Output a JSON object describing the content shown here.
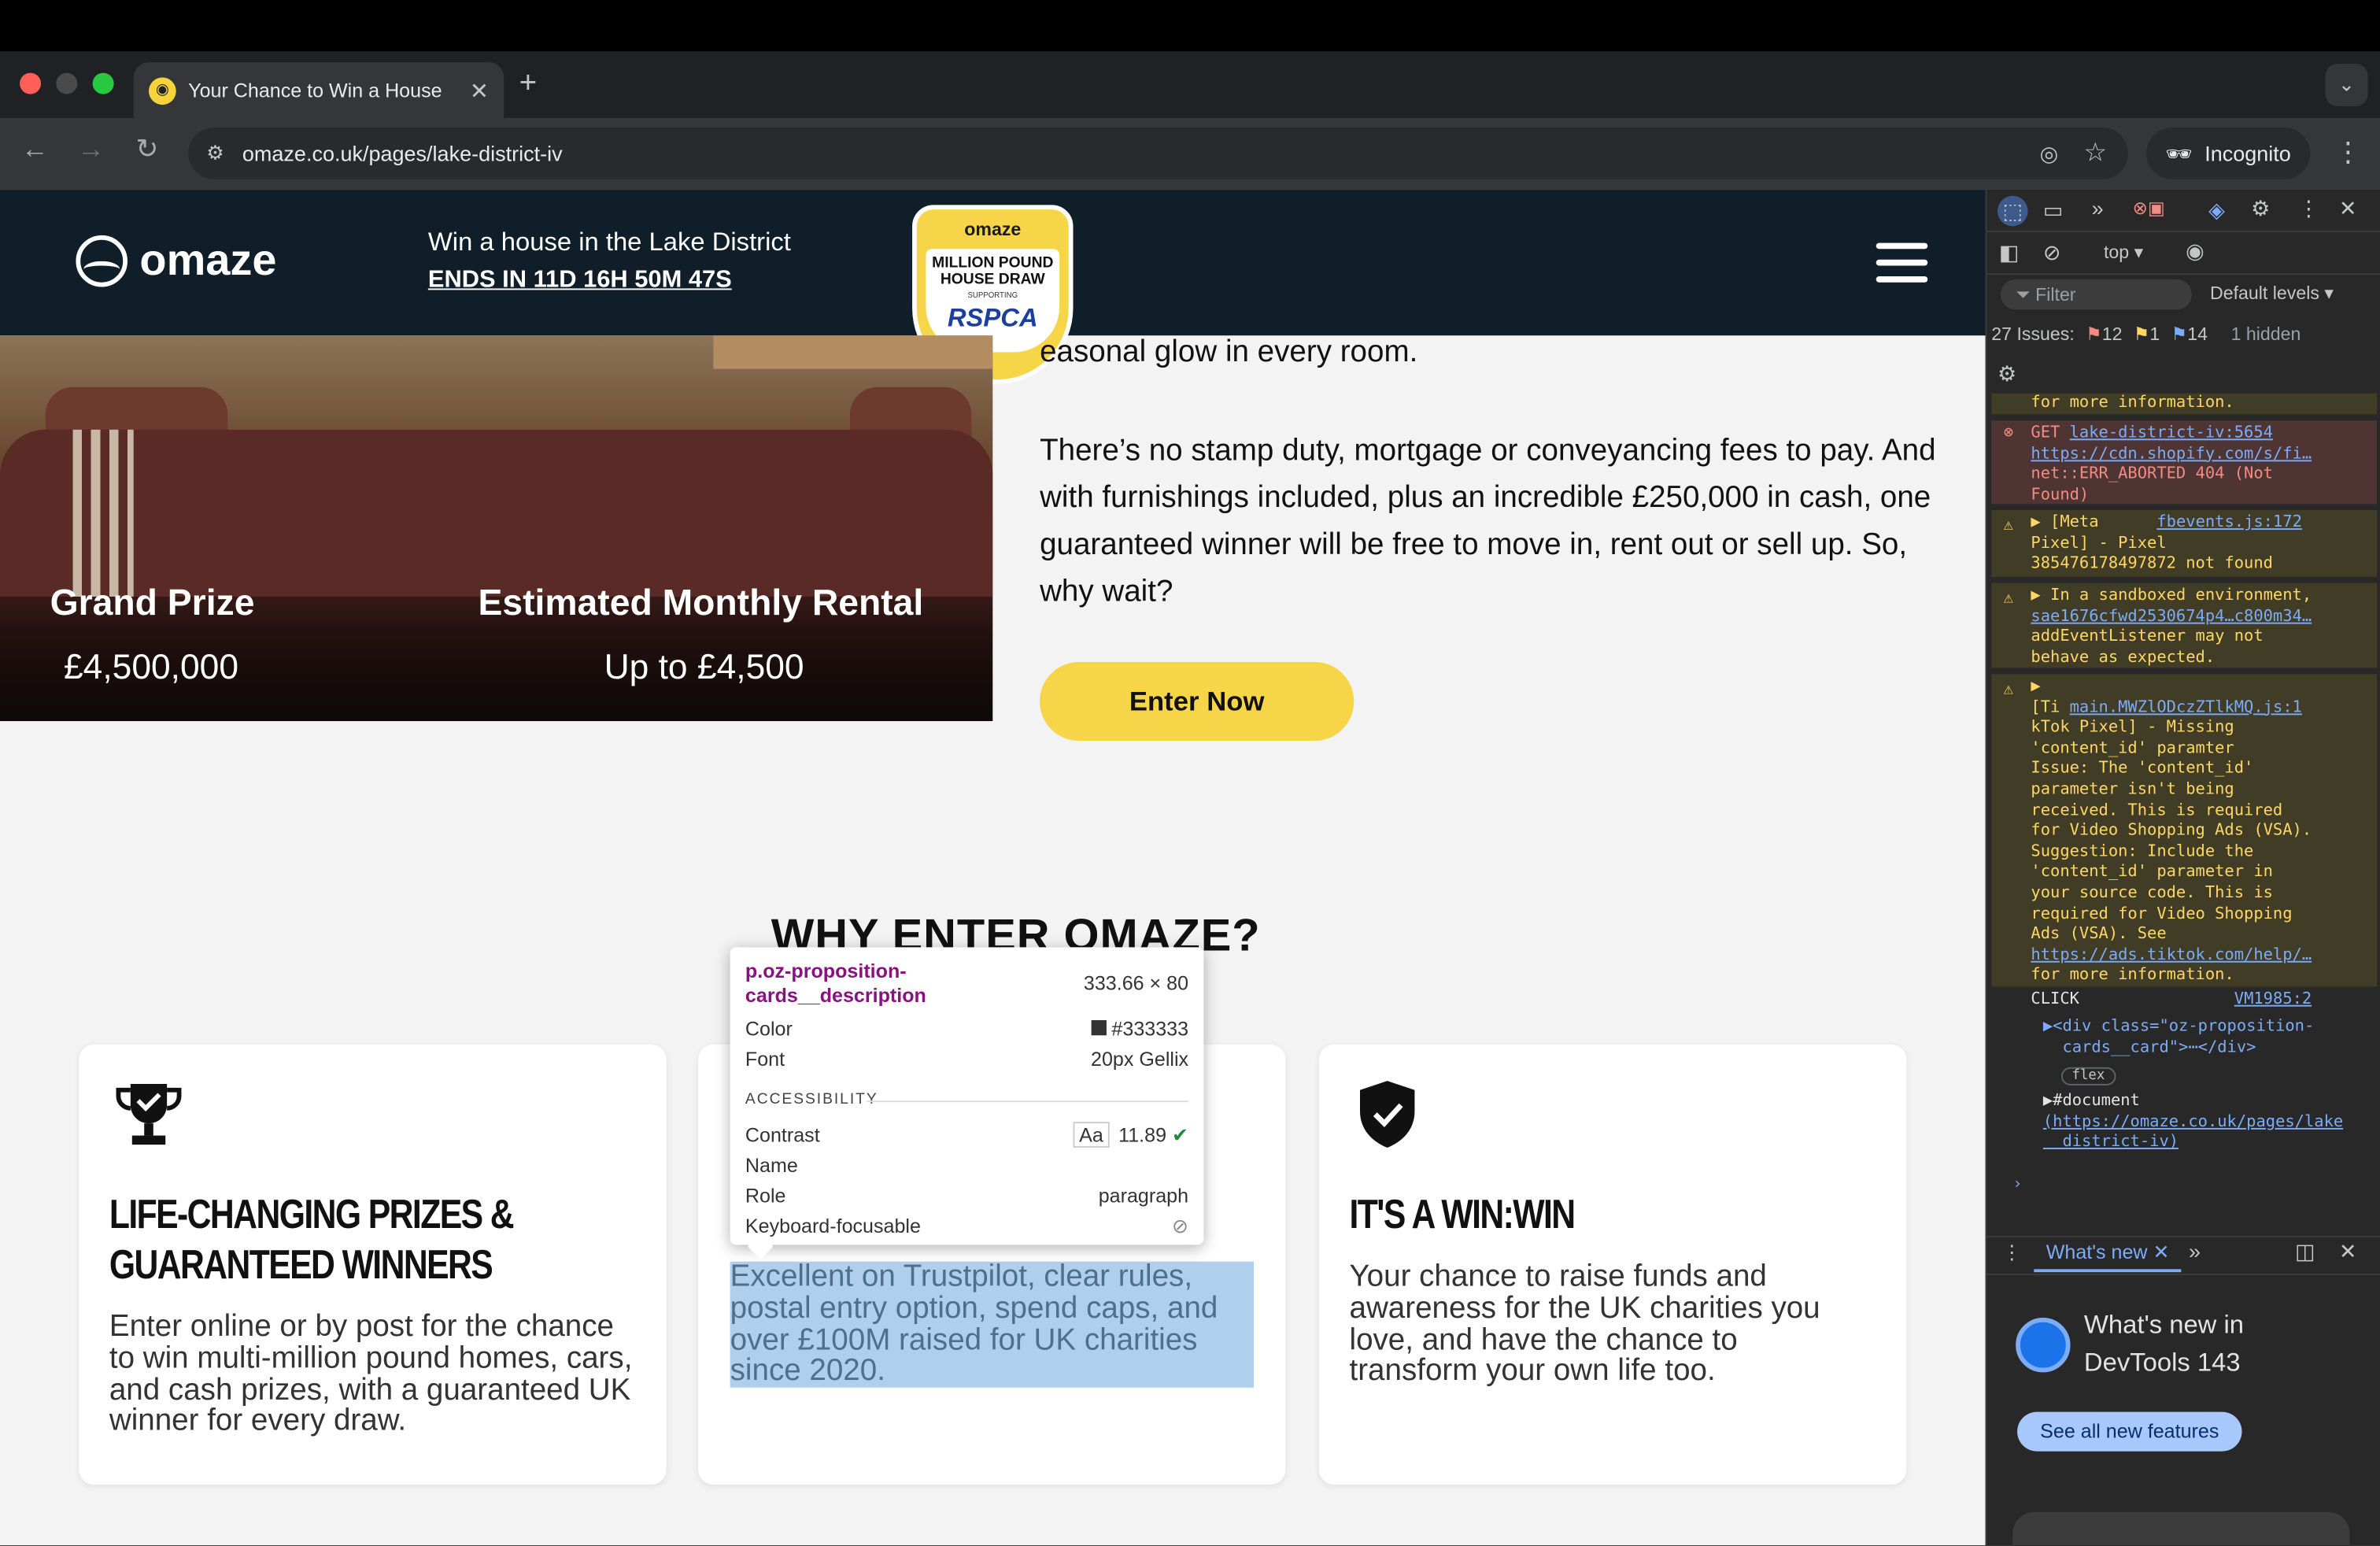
{
  "browser": {
    "tab_title": "Your Chance to Win a House",
    "url": "omaze.co.uk/pages/lake-district-iv",
    "incognito_label": "Incognito",
    "new_tab": "+",
    "close": "✕"
  },
  "site": {
    "logo": "omaze",
    "promo_title": "Win a house in the Lake District",
    "promo_countdown": "ENDS IN 11D 16H 50M 47S",
    "badge": {
      "brand": "omaze",
      "line1": "MILLION POUND",
      "line2": "HOUSE DRAW",
      "supporting": "SUPPORTING",
      "charity": "RSPCA"
    }
  },
  "hero": {
    "grand_prize_label": "Grand Prize",
    "grand_prize_value": "£4,500,000",
    "rental_label": "Estimated Monthly Rental",
    "rental_value": "Up to £4,500"
  },
  "copy": {
    "line_partial": "easonal glow in every room.",
    "paragraph": "There’s no stamp duty, mortgage or conveyancing fees to pay. And with furnishings included, plus an incredible £250,000 in cash, one guaranteed winner will be free to move in, rent out or sell up. So, why wait?",
    "enter_button": "Enter Now",
    "why_heading": "WHY ENTER OMAZE?"
  },
  "cards": [
    {
      "title": "LIFE-CHANGING PRIZES & GUARANTEED WINNERS",
      "desc": "Enter online or by post for the chance to win multi-million pound homes, cars, and cash prizes, with a guaranteed UK winner for every draw."
    },
    {
      "title": "",
      "desc": "Excellent on Trustpilot, clear rules, postal entry option, spend caps, and over £100M raised for UK charities since 2020."
    },
    {
      "title": "IT'S A WIN:WIN",
      "desc": "Your chance to raise funds and awareness for the UK charities you love, and have the chance to transform your own life too."
    }
  ],
  "inspect_tooltip": {
    "selector": "p.oz-proposition-cards__description",
    "dimensions": "333.66 × 80",
    "color_label": "Color",
    "color_value": "#333333",
    "font_label": "Font",
    "font_value": "20px Gellix",
    "accessibility": "ACCESSIBILITY",
    "contrast_label": "Contrast",
    "contrast_aa": "Aa",
    "contrast_value": "11.89",
    "name_label": "Name",
    "role_label": "Role",
    "role_value": "paragraph",
    "keyboard_label": "Keyboard-focusable"
  },
  "devtools": {
    "context": "top",
    "filter_placeholder": "Filter",
    "levels": "Default levels",
    "issues_label": "27 Issues:",
    "issues_errors": "12",
    "issues_warnings": "1",
    "issues_info": "14",
    "hidden": "1 hidden",
    "console": {
      "partial_top": "for more information.",
      "error_get": "GET ",
      "error_link": "lake-district-iv:5654",
      "error_cdn": "https://cdn.shopify.com/s/fi…",
      "error_net": "net::ERR_ABORTED 404 (Not\nFound)",
      "warn1_text": "▶ [Meta",
      "warn1_link": "fbevents.js:172",
      "warn1_rest": "Pixel] - Pixel\n385476178497872 not found",
      "warn2_text": "▶ In a sandboxed environment,",
      "warn2_link": "sae1676cfwd2530674p4…c800m34…",
      "warn2_rest": "addEventListener may not\nbehave as expected.",
      "warn3_head": "▶",
      "warn3_text": "[Ti ",
      "warn3_link": "main.MWZlODczZTlkMQ.js:1",
      "warn3_rest": "kTok Pixel] - Missing\n'content_id' paramter\nIssue: The 'content_id'\nparameter isn't being\nreceived. This is required\nfor Video Shopping Ads (VSA).\nSuggestion: Include the\n'content_id' parameter in\nyour source code. This is\nrequired for Video Shopping\nAds (VSA). See",
      "warn3_url": "https://ads.tiktok.com/help/…",
      "warn3_end": "for more information.",
      "click_label": "CLICK",
      "click_link": "VM1985:2",
      "div_text": "▶<div class=\"oz-proposition-\n  cards__card\">⋯</div>",
      "flex_badge": "flex",
      "doc_text": "▶#document",
      "doc_link": "(https://omaze.co.uk/pages/lake\n  district-iv)",
      "prompt": "›"
    },
    "whats_new_tab": "What's new",
    "whats_new_title": "What's new in\nDevTools 143",
    "whats_new_button": "See all new features"
  },
  "colors": {
    "brand_yellow": "#f6d548",
    "header_navy": "#0f1e28",
    "selection": "#6fa8dc"
  }
}
